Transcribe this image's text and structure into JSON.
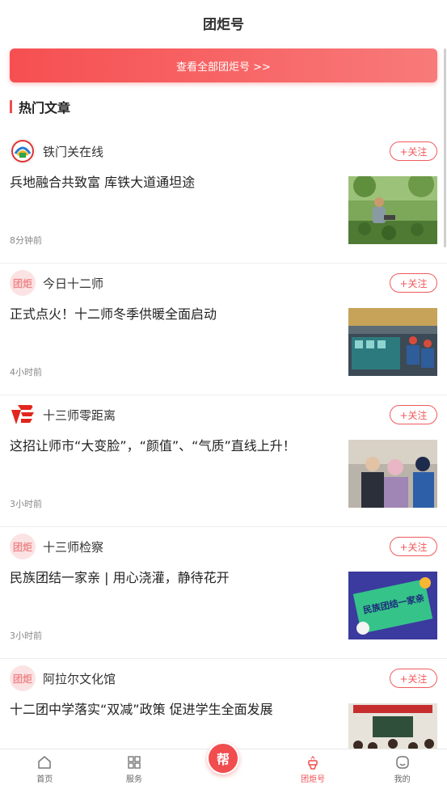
{
  "header": {
    "title": "团炬号"
  },
  "banner": {
    "label": "查看全部团炬号 >>"
  },
  "section": {
    "title": "热门文章"
  },
  "follow_label": "+关注",
  "articles": [
    {
      "author": "铁门关在线",
      "avatar": "tiemenguan-logo",
      "headline": "兵地融合共致富 库铁大道通坦途",
      "time": "8分钟前"
    },
    {
      "author": "今日十二师",
      "avatar_text": "团炬",
      "headline": "正式点火！十二师冬季供暖全面启动",
      "time": "4小时前"
    },
    {
      "author": "十三师零距离",
      "avatar": "shisanshi-logo",
      "headline": "这招让师市“大变脸”，“颜值”、“气质”直线上升！",
      "time": "3小时前"
    },
    {
      "author": "十三师检察",
      "avatar_text": "团炬",
      "headline": "民族团结一家亲 | 用心浇灌，静待花开",
      "time": "3小时前",
      "thumb_text": "民族团结一家亲"
    },
    {
      "author": "阿拉尔文化馆",
      "avatar_text": "团炬",
      "headline": "十二团中学落实“双减”政策 促进学生全面发展",
      "time": ""
    }
  ],
  "tabbar": {
    "home": "首页",
    "service": "服务",
    "help": "帮",
    "tuanju": "团炬号",
    "mine": "我的"
  },
  "colors": {
    "accent": "#f04d4f",
    "text": "#222222",
    "muted": "#888888"
  }
}
